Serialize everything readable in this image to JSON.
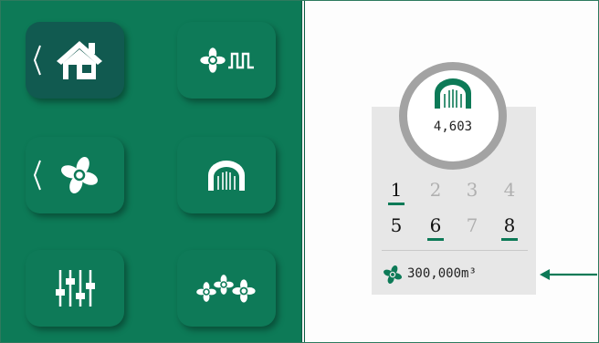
{
  "colors": {
    "panel": "#0d7a57",
    "tile": "#0e7a58",
    "tile_active": "#115a50",
    "accent": "#0d7a57"
  },
  "nav": {
    "tiles": [
      {
        "icon": "home-icon",
        "active": true,
        "chevron": true
      },
      {
        "icon": "fan-pulse-icon"
      },
      {
        "icon": "fan-icon",
        "chevron": true
      },
      {
        "icon": "tunnel-icon"
      },
      {
        "icon": "sliders-icon"
      },
      {
        "icon": "multi-fan-icon"
      }
    ]
  },
  "status": {
    "count": "4,603",
    "count_icon": "tunnel-icon",
    "stages": [
      {
        "label": "1",
        "active": true,
        "underlined": true
      },
      {
        "label": "2",
        "active": false
      },
      {
        "label": "3",
        "active": false
      },
      {
        "label": "4",
        "active": false
      },
      {
        "label": "5",
        "active": true
      },
      {
        "label": "6",
        "active": true,
        "underlined": true
      },
      {
        "label": "7",
        "active": false
      },
      {
        "label": "8",
        "active": true,
        "underlined": true
      }
    ],
    "flow": "300,000m³",
    "flow_icon": "fan-icon"
  }
}
